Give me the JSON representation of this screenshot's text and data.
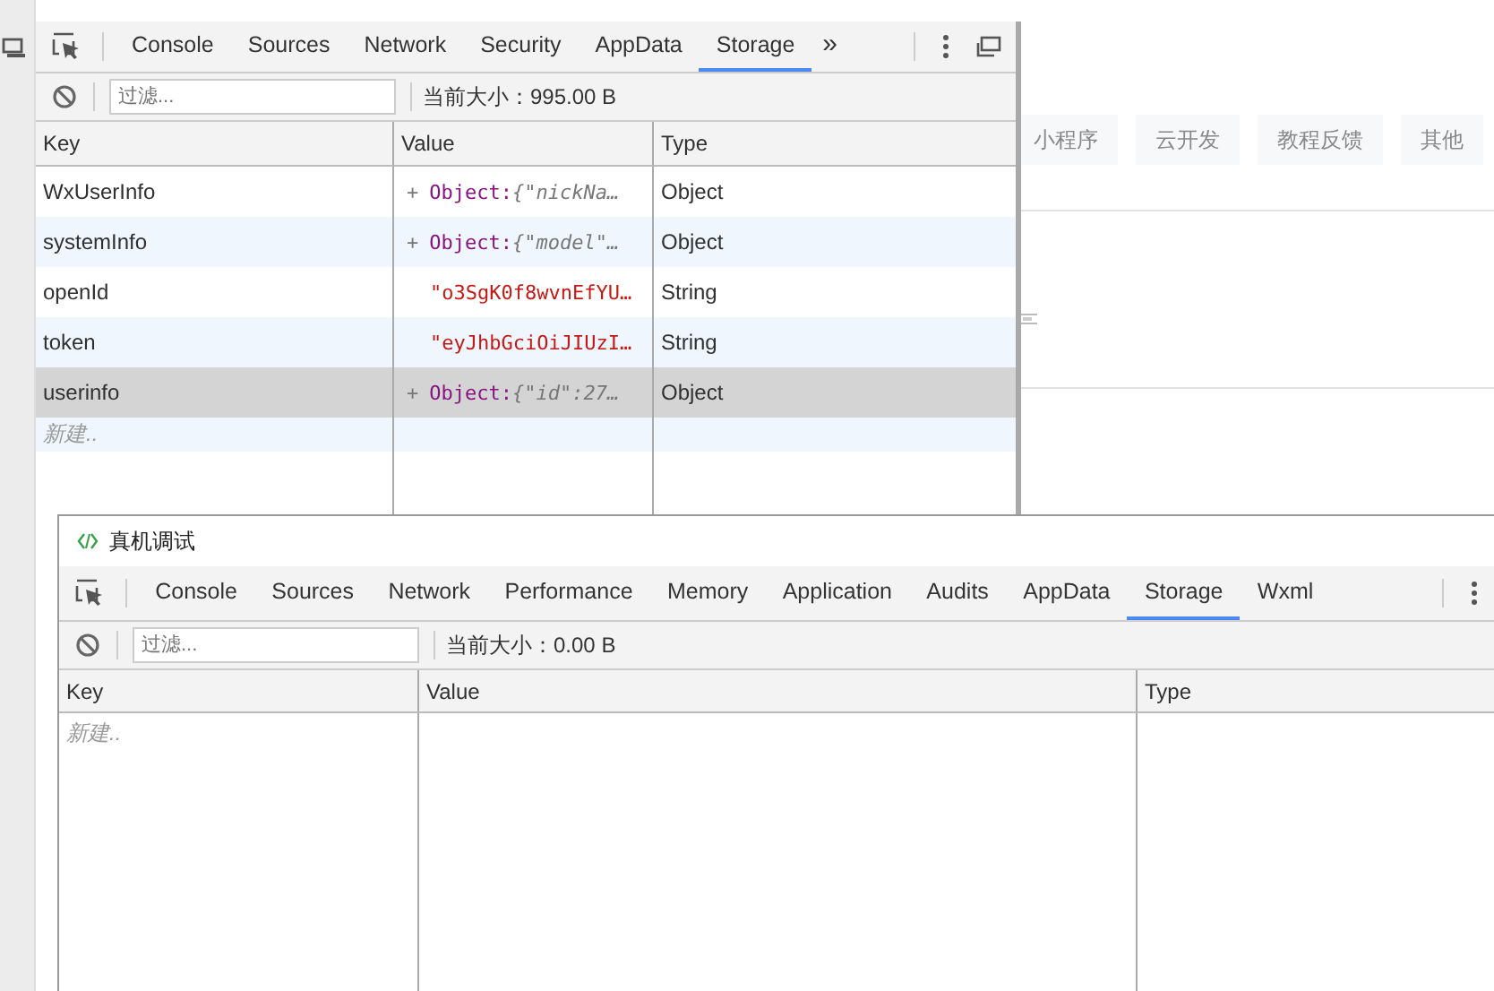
{
  "background_page": {
    "tabs": [
      {
        "label": "小程序"
      },
      {
        "label": "云开发"
      },
      {
        "label": "教程反馈"
      },
      {
        "label": "其他"
      }
    ]
  },
  "top_devtools": {
    "tabs": [
      {
        "label": "Console",
        "selected": false
      },
      {
        "label": "Sources",
        "selected": false
      },
      {
        "label": "Network",
        "selected": false
      },
      {
        "label": "Security",
        "selected": false
      },
      {
        "label": "AppData",
        "selected": false
      },
      {
        "label": "Storage",
        "selected": true
      }
    ],
    "more_tabs": "»",
    "filter": {
      "placeholder": "过滤..."
    },
    "size": "当前大小：995.00 B",
    "columns": [
      "Key",
      "Value",
      "Type"
    ],
    "rows": [
      {
        "key": "WxUserInfo",
        "value": {
          "kind": "object",
          "toggle": "+",
          "label": "Object:",
          "preview": "{\"nickNa…"
        },
        "type": "Object",
        "selected": false
      },
      {
        "key": "systemInfo",
        "value": {
          "kind": "object",
          "toggle": "+",
          "label": "Object:",
          "preview": "{\"model\"…"
        },
        "type": "Object",
        "selected": false
      },
      {
        "key": "openId",
        "value": {
          "kind": "string",
          "text": "\"o3SgK0f8wvnEfYU…"
        },
        "type": "String",
        "selected": false
      },
      {
        "key": "token",
        "value": {
          "kind": "string",
          "text": "\"eyJhbGciOiJIUzI…"
        },
        "type": "String",
        "selected": false
      },
      {
        "key": "userinfo",
        "value": {
          "kind": "object",
          "toggle": "+",
          "label": "Object:",
          "preview": "{\"id\":27…"
        },
        "type": "Object",
        "selected": true
      }
    ],
    "new_row": "新建.."
  },
  "bottom_devtools": {
    "title": "真机调试",
    "tabs": [
      {
        "label": "Console",
        "selected": false
      },
      {
        "label": "Sources",
        "selected": false
      },
      {
        "label": "Network",
        "selected": false
      },
      {
        "label": "Performance",
        "selected": false
      },
      {
        "label": "Memory",
        "selected": false
      },
      {
        "label": "Application",
        "selected": false
      },
      {
        "label": "Audits",
        "selected": false
      },
      {
        "label": "AppData",
        "selected": false
      },
      {
        "label": "Storage",
        "selected": true
      },
      {
        "label": "Wxml",
        "selected": false
      }
    ],
    "filter": {
      "placeholder": "过滤..."
    },
    "size": "当前大小：0.00 B",
    "columns": [
      "Key",
      "Value",
      "Type"
    ],
    "new_row": "新建.."
  }
}
